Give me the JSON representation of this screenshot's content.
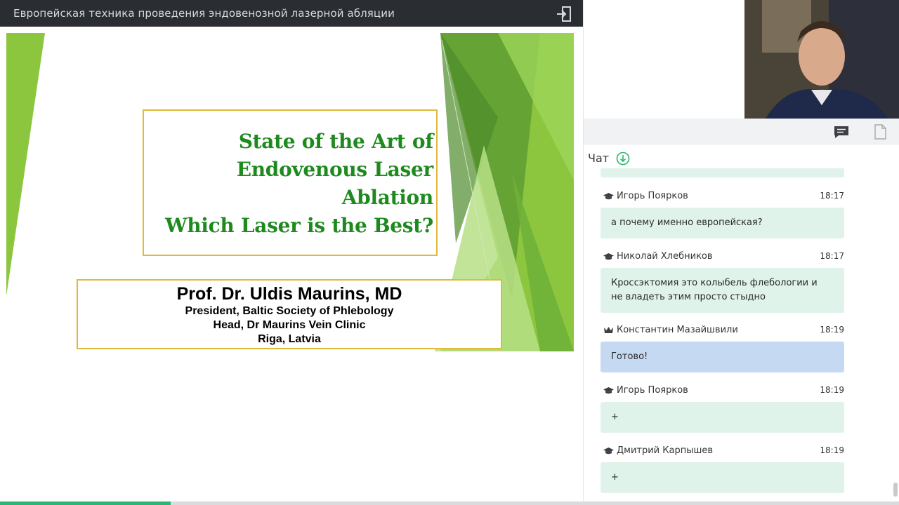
{
  "window": {
    "title": "Европейская техника проведения эндовенозной лазерной абляции"
  },
  "slide": {
    "title_lines": [
      "State of the Art of",
      "Endovenous Laser",
      "Ablation",
      "Which Laser is the Best?"
    ],
    "author_name": "Prof. Dr. Uldis Maurins, MD",
    "author_lines": [
      "President, Baltic Society of Phlebology",
      "Head, Dr Maurins Vein Clinic",
      "Riga, Latvia"
    ],
    "colors": {
      "title_text": "#1e8a1e",
      "box_border": "#e0b93a",
      "accent_green": "#8cc63f"
    }
  },
  "progress": {
    "fraction": 0.19
  },
  "chat": {
    "title": "Чат",
    "messages": [
      {
        "author": "Игорь Поярков",
        "time": "18:17",
        "role": "student",
        "lines": [
          "а почему именно европейская?"
        ]
      },
      {
        "author": "Николай Хлебников",
        "time": "18:17",
        "role": "student",
        "lines": [
          "Кроссэктомия это колыбель флебологии и",
          "не владеть этим просто стыдно"
        ]
      },
      {
        "author": "Константин Мазайшвили",
        "time": "18:19",
        "role": "host",
        "lines": [
          "Готово!"
        ]
      },
      {
        "author": "Игорь Поярков",
        "time": "18:19",
        "role": "student",
        "lines": [
          "+"
        ]
      },
      {
        "author": "Дмитрий Карпышев",
        "time": "18:19",
        "role": "student",
        "lines": [
          "+"
        ]
      }
    ]
  },
  "icons": {
    "exit": "exit-icon",
    "chat_tab": "chat-bubble-icon",
    "files_tab": "document-icon",
    "scroll_down": "arrow-down-circle-icon",
    "student": "graduation-cap-icon",
    "host": "crown-icon"
  }
}
